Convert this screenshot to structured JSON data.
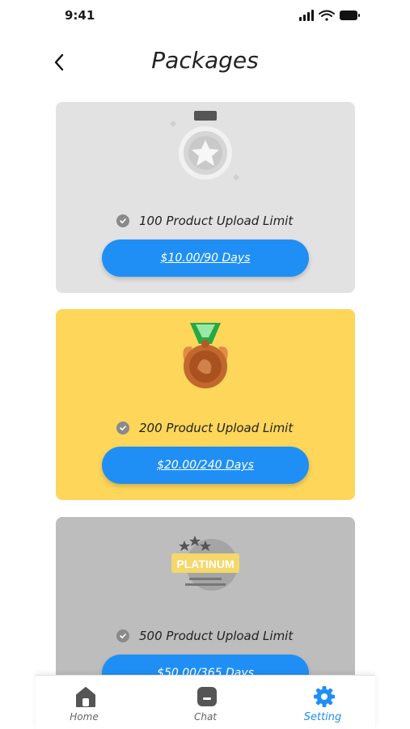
{
  "status": {
    "time": "9:41"
  },
  "header": {
    "title": "Packages",
    "back_icon": "chevron-left-icon"
  },
  "colors": {
    "accent": "#1f8ff5",
    "silver_card": "#e2e2e2",
    "gold_card": "#fdd65a",
    "platinum_card": "#bdbdbd"
  },
  "packages": [
    {
      "badge_icon": "silver-medal-icon",
      "feature": "100 Product Upload Limit",
      "price_label": "$10.00/90 Days"
    },
    {
      "badge_icon": "bronze-medal-icon",
      "feature": "200 Product Upload Limit",
      "price_label": "$20.00/240 Days"
    },
    {
      "badge_icon": "platinum-badge-icon",
      "badge_text": "PLATINUM",
      "feature": "500 Product Upload Limit",
      "price_label": "$50.00/365 Days"
    }
  ],
  "tabs": [
    {
      "label": "Home",
      "icon": "home-icon",
      "active": false
    },
    {
      "label": "Chat",
      "icon": "chat-icon",
      "active": false
    },
    {
      "label": "Setting",
      "icon": "gear-icon",
      "active": true
    }
  ]
}
